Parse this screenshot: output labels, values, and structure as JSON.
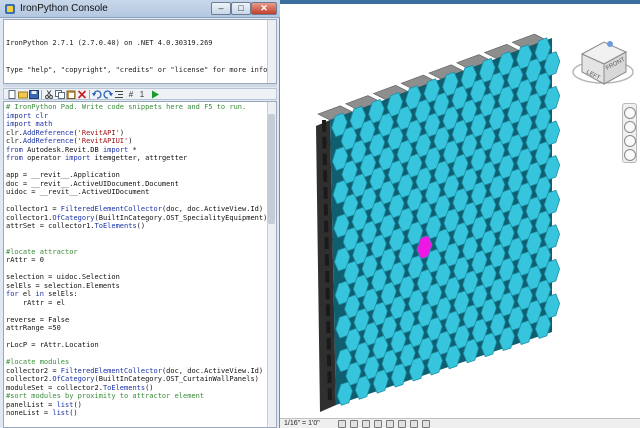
{
  "window": {
    "title": "IronPython Console",
    "minimize_glyph": "–",
    "maximize_glyph": "□",
    "close_glyph": "✕"
  },
  "console": {
    "lines": [
      "IronPython 2.7.1 (2.7.0.40) on .NET 4.0.30319.269",
      "Type \"help\", \"copyright\", \"credits\" or \"license\" for more information.",
      ">>>"
    ]
  },
  "toolbar": {
    "run_count": "1",
    "hash_glyph": "#"
  },
  "editor": {
    "lines": [
      {
        "t": "cm",
        "s": "# IronPython Pad. Write code snippets here and F5 to run."
      },
      {
        "t": "kw",
        "s": "import clr"
      },
      {
        "t": "kw",
        "s": "import math"
      },
      {
        "t": "mix",
        "parts": [
          {
            "t": "n",
            "s": "clr."
          },
          {
            "t": "fn",
            "s": "AddReference"
          },
          {
            "t": "n",
            "s": "("
          },
          {
            "t": "st",
            "s": "'RevitAPI'"
          },
          {
            "t": "n",
            "s": ")"
          }
        ]
      },
      {
        "t": "mix",
        "parts": [
          {
            "t": "n",
            "s": "clr."
          },
          {
            "t": "fn",
            "s": "AddReference"
          },
          {
            "t": "n",
            "s": "("
          },
          {
            "t": "st",
            "s": "'RevitAPIUI'"
          },
          {
            "t": "n",
            "s": ")"
          }
        ]
      },
      {
        "t": "mix",
        "parts": [
          {
            "t": "kw",
            "s": "from"
          },
          {
            "t": "n",
            "s": " Autodesk.Revit.DB "
          },
          {
            "t": "kw",
            "s": "import"
          },
          {
            "t": "n",
            "s": " *"
          }
        ]
      },
      {
        "t": "mix",
        "parts": [
          {
            "t": "kw",
            "s": "from"
          },
          {
            "t": "n",
            "s": " operator "
          },
          {
            "t": "kw",
            "s": "import"
          },
          {
            "t": "n",
            "s": " itemgetter, attrgetter"
          }
        ]
      },
      {
        "t": "n",
        "s": ""
      },
      {
        "t": "n",
        "s": "app = __revit__.Application"
      },
      {
        "t": "n",
        "s": "doc = __revit__.ActiveUIDocument.Document"
      },
      {
        "t": "n",
        "s": "uidoc = __revit__.ActiveUIDocument"
      },
      {
        "t": "n",
        "s": ""
      },
      {
        "t": "mix",
        "parts": [
          {
            "t": "n",
            "s": "collector1 = "
          },
          {
            "t": "fn",
            "s": "FilteredElementCollector"
          },
          {
            "t": "n",
            "s": "(doc, doc.ActiveView.Id)"
          }
        ]
      },
      {
        "t": "mix",
        "parts": [
          {
            "t": "n",
            "s": "collector1."
          },
          {
            "t": "fn",
            "s": "OfCategory"
          },
          {
            "t": "n",
            "s": "(BuiltInCategory.OST_SpecialityEquipment)"
          }
        ]
      },
      {
        "t": "mix",
        "parts": [
          {
            "t": "n",
            "s": "attrSet = collector1."
          },
          {
            "t": "fn",
            "s": "ToElements"
          },
          {
            "t": "n",
            "s": "()"
          }
        ]
      },
      {
        "t": "n",
        "s": ""
      },
      {
        "t": "n",
        "s": ""
      },
      {
        "t": "cm",
        "s": "#locate attractor"
      },
      {
        "t": "n",
        "s": "rAttr = 0"
      },
      {
        "t": "n",
        "s": ""
      },
      {
        "t": "n",
        "s": "selection = uidoc.Selection"
      },
      {
        "t": "n",
        "s": "selEls = selection.Elements"
      },
      {
        "t": "mix",
        "parts": [
          {
            "t": "kw",
            "s": "for"
          },
          {
            "t": "n",
            "s": " el "
          },
          {
            "t": "kw",
            "s": "in"
          },
          {
            "t": "n",
            "s": " selEls:"
          }
        ]
      },
      {
        "t": "n",
        "s": "    rAttr = el"
      },
      {
        "t": "n",
        "s": ""
      },
      {
        "t": "n",
        "s": "reverse = False"
      },
      {
        "t": "n",
        "s": "attrRange =50"
      },
      {
        "t": "n",
        "s": ""
      },
      {
        "t": "n",
        "s": "rLocP = rAttr.Location"
      },
      {
        "t": "n",
        "s": ""
      },
      {
        "t": "cm",
        "s": "#locate modules"
      },
      {
        "t": "mix",
        "parts": [
          {
            "t": "n",
            "s": "collector2 = "
          },
          {
            "t": "fn",
            "s": "FilteredElementCollector"
          },
          {
            "t": "n",
            "s": "(doc, doc.ActiveView.Id)"
          }
        ]
      },
      {
        "t": "mix",
        "parts": [
          {
            "t": "n",
            "s": "collector2."
          },
          {
            "t": "fn",
            "s": "OfCategory"
          },
          {
            "t": "n",
            "s": "(BuiltInCategory.OST_CurtainWallPanels)"
          }
        ]
      },
      {
        "t": "mix",
        "parts": [
          {
            "t": "n",
            "s": "moduleSet = collector2."
          },
          {
            "t": "fn",
            "s": "ToElements"
          },
          {
            "t": "n",
            "s": "()"
          }
        ]
      },
      {
        "t": "cm",
        "s": "#sort modules by proximity to attractor element"
      },
      {
        "t": "mix",
        "parts": [
          {
            "t": "n",
            "s": "panelList = "
          },
          {
            "t": "fn",
            "s": "list"
          },
          {
            "t": "n",
            "s": "()"
          }
        ]
      },
      {
        "t": "mix",
        "parts": [
          {
            "t": "n",
            "s": "noneList = "
          },
          {
            "t": "fn",
            "s": "list"
          },
          {
            "t": "n",
            "s": "()"
          }
        ]
      }
    ]
  },
  "viewcube": {
    "faces": [
      "LEFT",
      "FRONT"
    ]
  },
  "statusbar": {
    "scale": "1/16\" = 1'0\""
  },
  "colors": {
    "panel_cyan": "#36c5dc",
    "panel_edge": "#1d8fa6",
    "frame_dark": "#2f2f2f",
    "cap_gray": "#8e8e8e",
    "attractor_magenta": "#ee17e6"
  },
  "icons": [
    "python-icon",
    "new-file-icon",
    "open-icon",
    "save-icon",
    "cut-icon",
    "copy-icon",
    "paste-icon",
    "delete-icon",
    "undo-icon",
    "redo-icon",
    "indent-icon",
    "comment-icon",
    "run-icon"
  ]
}
